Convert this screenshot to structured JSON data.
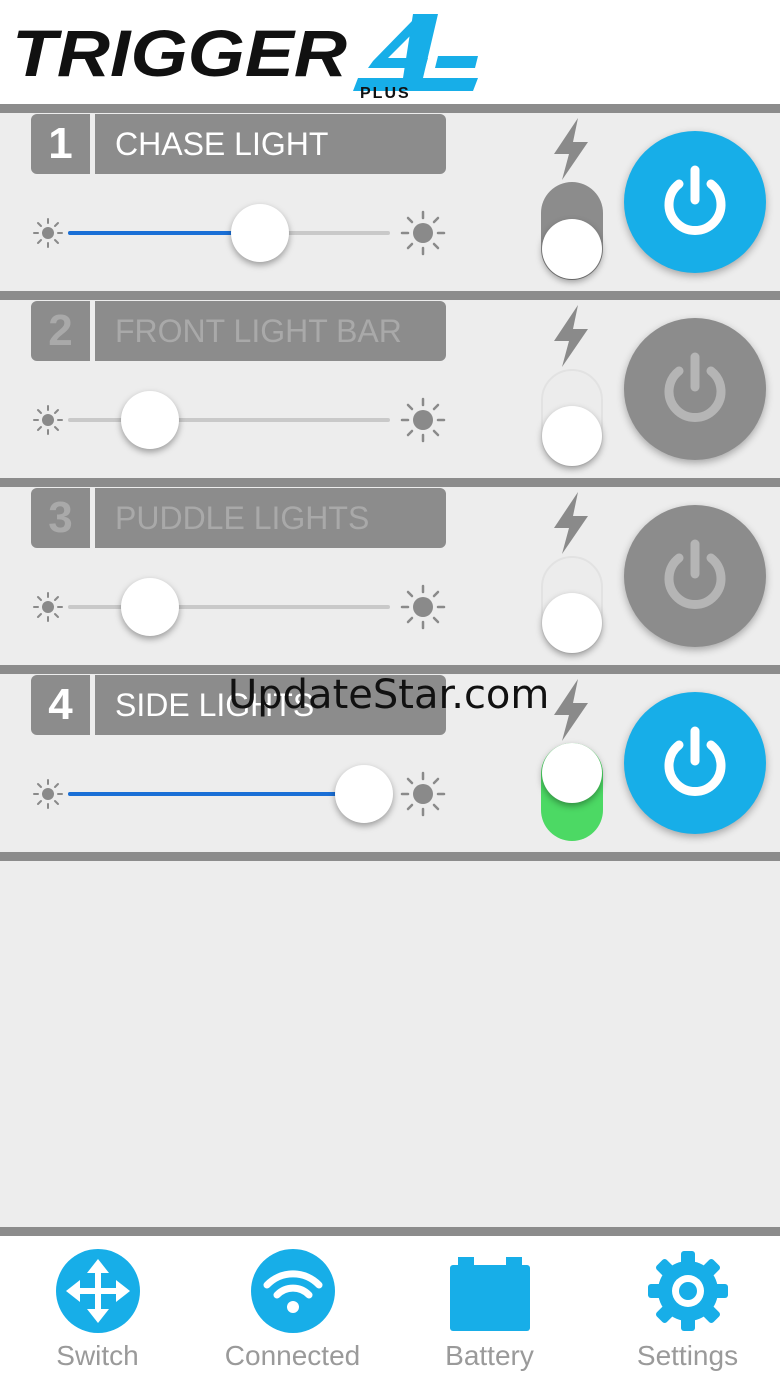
{
  "brand": {
    "logo_text": "TRIGGER",
    "logo_number": "4",
    "logo_sub": "PLUS"
  },
  "colors": {
    "accent_blue": "#17aee8",
    "slider_blue": "#1a6fd6",
    "panel_gray": "#8c8c8c",
    "toggle_green": "#4cd964",
    "power_off_gray": "#8c8c8c"
  },
  "channels": [
    {
      "number": "1",
      "name": "CHASE LIGHT",
      "brightness": 0.59,
      "active": true,
      "strobe_toggle": "gray",
      "power": "on"
    },
    {
      "number": "2",
      "name": "FRONT LIGHT BAR",
      "brightness": 0.25,
      "active": false,
      "strobe_toggle": "off",
      "power": "off"
    },
    {
      "number": "3",
      "name": "PUDDLE LIGHTS",
      "brightness": 0.25,
      "active": false,
      "strobe_toggle": "off",
      "power": "off"
    },
    {
      "number": "4",
      "name": "SIDE LIGHTS",
      "brightness": 0.92,
      "active": true,
      "strobe_toggle": "on",
      "power": "on"
    }
  ],
  "icons": {
    "brightness_low": "sun-small-icon",
    "brightness_high": "sun-large-icon",
    "strobe": "lightning-bolt-icon",
    "power": "power-icon"
  },
  "watermark": "UpdateStar.com",
  "tabs": [
    {
      "label": "Switch",
      "icon": "move-arrows-icon"
    },
    {
      "label": "Connected",
      "icon": "wifi-icon"
    },
    {
      "label": "Battery",
      "icon": "battery-icon"
    },
    {
      "label": "Settings",
      "icon": "gear-icon"
    }
  ]
}
